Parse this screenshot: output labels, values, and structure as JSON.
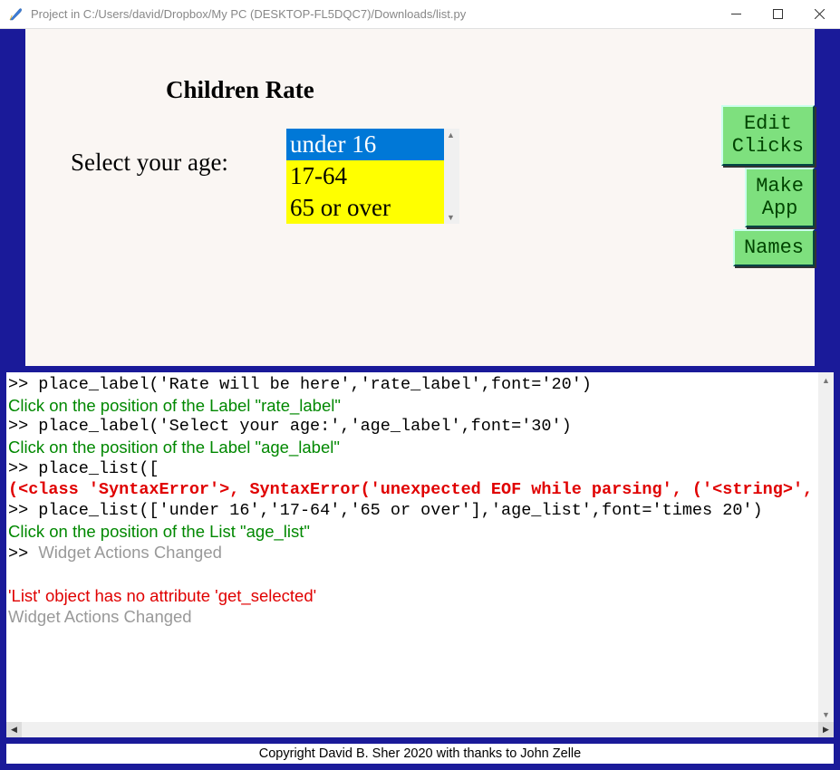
{
  "window": {
    "title": "Project in C:/Users/david/Dropbox/My PC (DESKTOP-FL5DQC7)/Downloads/list.py"
  },
  "canvas": {
    "heading": "Children Rate",
    "age_label": "Select your age:",
    "list_items": [
      "under 16",
      "17-64",
      "65 or over"
    ],
    "selected_index": 0
  },
  "buttons": {
    "edit_clicks": "Edit\nClicks",
    "make_app": "Make\nApp",
    "names": "Names"
  },
  "console": {
    "lines": [
      {
        "cls": "c-mono",
        "t": ">> place_label('Rate will be here','rate_label',font='20')"
      },
      {
        "cls": "c-sans c-green",
        "t": "Click on the position of the Label \"rate_label\""
      },
      {
        "cls": "c-mono",
        "t": ">> place_label('Select your age:','age_label',font='30')"
      },
      {
        "cls": "c-sans c-green",
        "t": "Click on the position of the Label \"age_label\""
      },
      {
        "cls": "c-mono",
        "t": ">> place_list(["
      },
      {
        "cls": "c-redb",
        "t": "(<class 'SyntaxError'>, SyntaxError('unexpected EOF while parsing', ('<string>',"
      },
      {
        "cls": "c-mono",
        "t": ">> place_list(['under 16','17-64','65 or over'],'age_list',font='times 20')"
      },
      {
        "cls": "c-sans c-green",
        "t": "Click on the position of the List \"age_list\""
      },
      {
        "cls": "c-mix",
        "prefix": ">> ",
        "t": "Widget Actions Changed"
      },
      {
        "cls": "blank",
        "t": ""
      },
      {
        "cls": "c-sans c-red",
        "t": "'List' object has no attribute 'get_selected'"
      },
      {
        "cls": "c-sans c-gray",
        "t": "Widget Actions Changed"
      }
    ]
  },
  "footer": "Copyright David B. Sher 2020 with thanks to John Zelle"
}
